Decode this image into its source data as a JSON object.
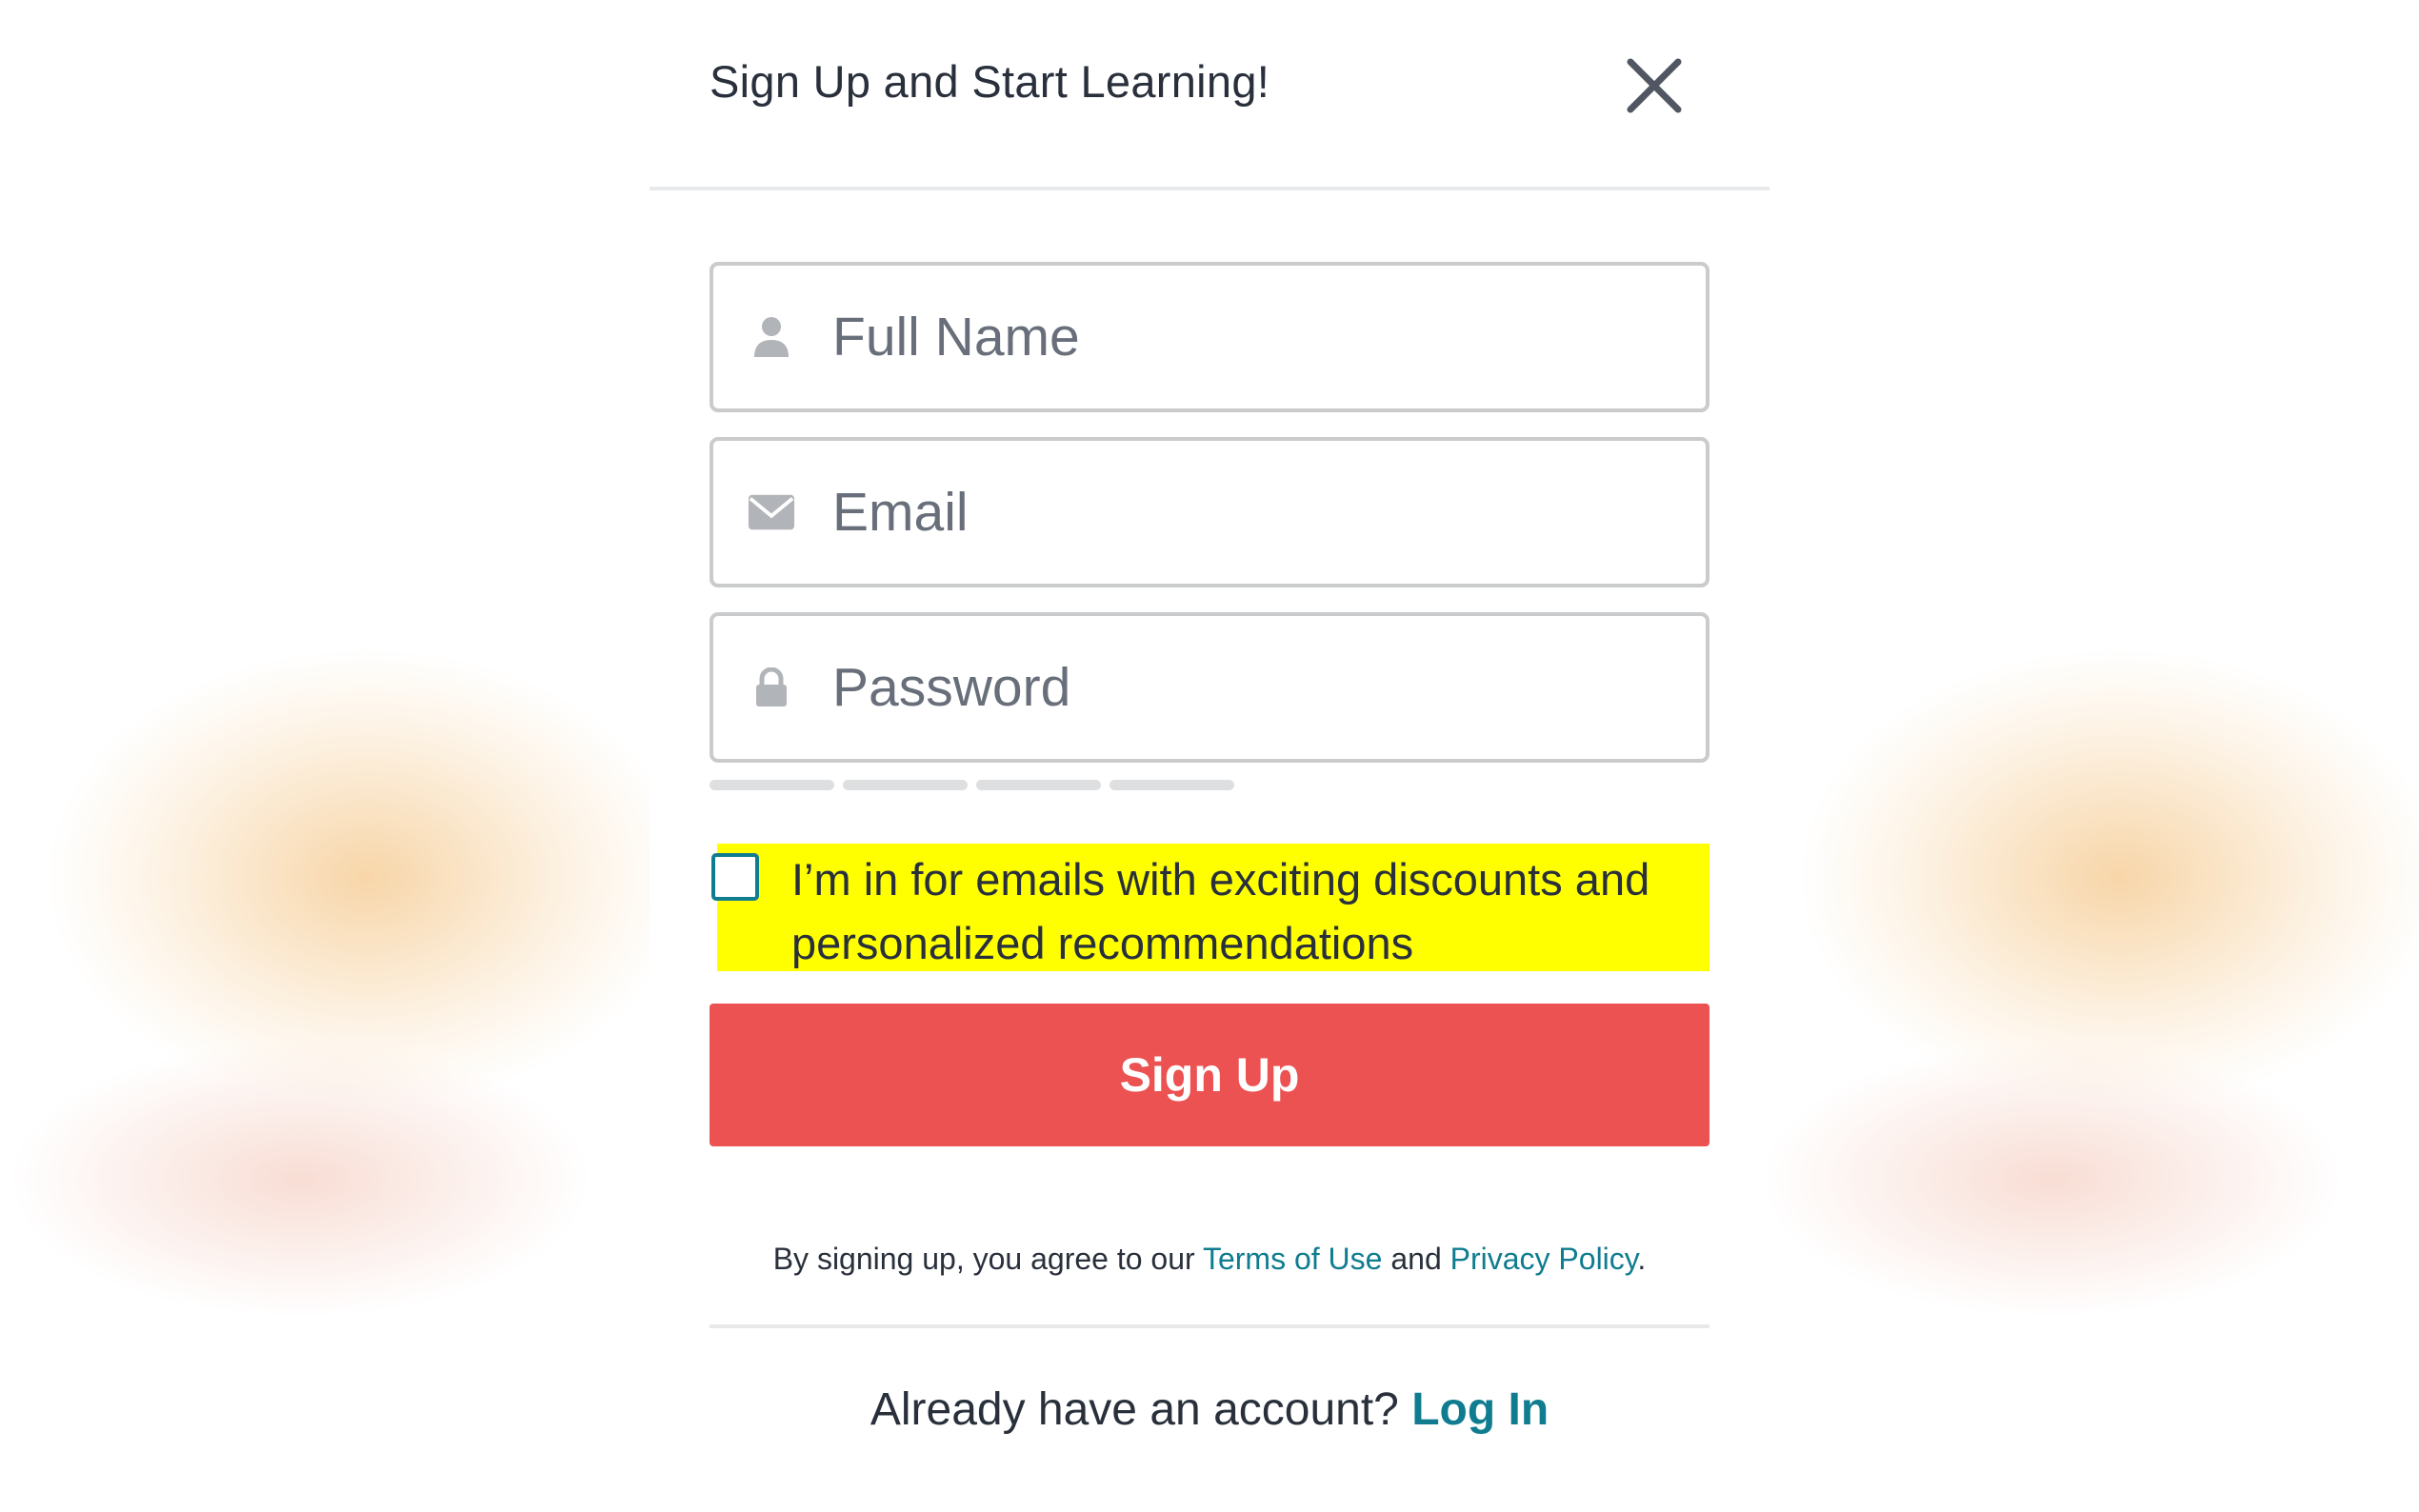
{
  "modal": {
    "title": "Sign Up and Start Learning!",
    "close_icon": "close-icon"
  },
  "form": {
    "full_name": {
      "placeholder": "Full Name",
      "value": "",
      "icon": "user-icon"
    },
    "email": {
      "placeholder": "Email",
      "value": "",
      "icon": "envelope-icon"
    },
    "password": {
      "placeholder": "Password",
      "value": "",
      "icon": "lock-icon"
    },
    "password_strength_segments_filled": 0,
    "optin": {
      "checked": false,
      "label": "I’m in for emails with exciting discounts and personalized recommendations",
      "highlight_color": "#ffff00"
    },
    "submit_label": "Sign Up"
  },
  "terms": {
    "prefix": "By signing up, you agree to our ",
    "terms_link": "Terms of Use",
    "middle": " and ",
    "privacy_link": "Privacy Policy",
    "suffix": "."
  },
  "login": {
    "prompt": "Already have an account? ",
    "link": "Log In"
  },
  "colors": {
    "accent": "#0f7c90",
    "button": "#ec5252",
    "text": "#29303b"
  }
}
